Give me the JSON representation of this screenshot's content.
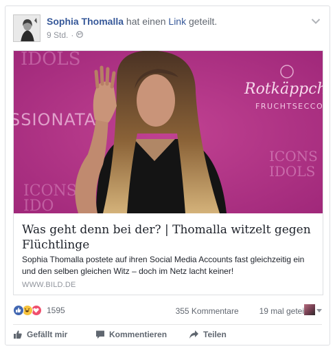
{
  "post": {
    "author": "Sophia Thomalla",
    "action_prefix": "hat einen",
    "action_link": "Link",
    "action_suffix": "geteilt.",
    "time": "9 Std.",
    "separator": "·",
    "privacy_icon": "globe-icon"
  },
  "link_preview": {
    "image_texts": {
      "left_brand": "SSIONATA",
      "top_left": "IDOLS",
      "right_brand": "Rotkäppchen",
      "right_sub": "FRUCHTSECCO",
      "icons_right": "ICONS",
      "idols_right": "IDOLS",
      "icons_left": "ICONS",
      "idols_left": "IDO"
    },
    "title": "Was geht denn bei der? | Thomalla witzelt gegen Flüchtlinge",
    "description": "Sophia Thomalla postete auf ihren Social Media Accounts fast gleichzeitig ein und den selben gleichen Witz – doch im Netz lacht keiner!",
    "domain": "WWW.BILD.DE"
  },
  "stats": {
    "reaction_count": "1595",
    "reactions": [
      "like",
      "haha",
      "love"
    ],
    "comments": "355 Kommentare",
    "shares": "19 mal geteilt"
  },
  "actions": {
    "like": "Gefällt mir",
    "comment": "Kommentieren",
    "share": "Teilen"
  },
  "colors": {
    "brand_link": "#365899",
    "photo_bg": "#b0307f",
    "muted": "#90949c"
  }
}
